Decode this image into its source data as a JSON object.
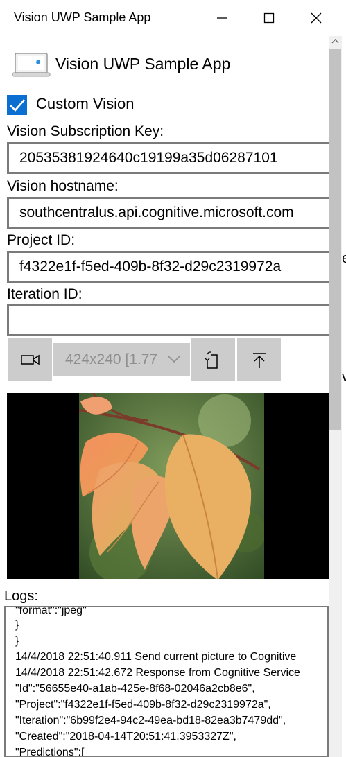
{
  "window": {
    "title": "Vision UWP Sample App",
    "controls": [
      "minimize-icon",
      "maximize-icon",
      "close-icon"
    ]
  },
  "header": {
    "icon": "app-laptop-icon",
    "title": "Vision UWP Sample App"
  },
  "custom_vision": {
    "checked": true,
    "label": "Custom Vision"
  },
  "form": {
    "subscription_key_label": "Vision Subscription Key:",
    "subscription_key_value": "20535381924640c19199a35d06287101",
    "hostname_label": "Vision hostname:",
    "hostname_value": "southcentralus.api.cognitive.microsoft.com",
    "project_id_label": "Project ID:",
    "project_id_value": "f4322e1f-f5ed-409b-8f32-d29c2319972a",
    "iteration_id_label": "Iteration ID:",
    "iteration_id_value": ""
  },
  "toolbar": {
    "camera_icon": "camera-icon",
    "resolution_value": "424x240 [1.77",
    "rotate_icon": "rotate-icon",
    "upload_icon": "upload-icon"
  },
  "preview": {
    "description_icon": "preview-photo"
  },
  "logs": {
    "label": "Logs:",
    "lines": [
      "\"format\":\"jpeg\"",
      "}",
      "}",
      "14/4/2018 22:51:40.911 Send current picture to Cognitive",
      "14/4/2018 22:51:42.672 Response from Cognitive Service",
      "\"Id\":\"56655e40-a1ab-425e-8f68-02046a2cb8e6\",",
      "\"Project\":\"f4322e1f-f5ed-409b-8f32-d29c2319972a\",",
      "\"Iteration\":\"6b99f2e4-94c2-49ea-bd18-82ea3b7479dd\",",
      "\"Created\":\"2018-04-14T20:51:41.3953327Z\",",
      "\"Predictions\":["
    ]
  },
  "background_window_text": [
    "e",
    "v"
  ],
  "colors": {
    "accent": "#0a6fd1",
    "button_bg": "#cccccc",
    "border": "#7a7a7a"
  }
}
